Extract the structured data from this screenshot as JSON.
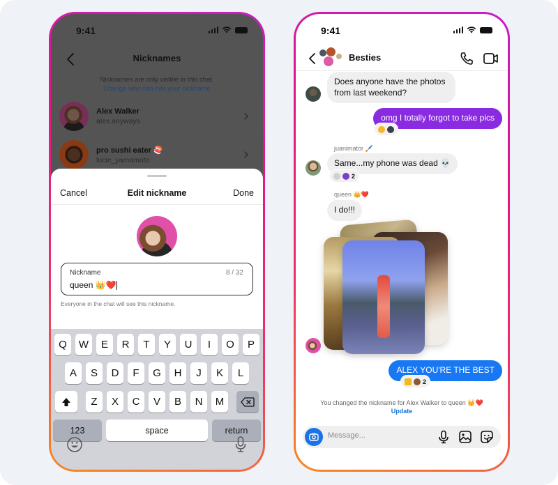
{
  "status_bar": {
    "time": "9:41"
  },
  "left_phone": {
    "nav": {
      "title": "Nicknames"
    },
    "note": {
      "line1": "Nicknames are only visible in this chat.",
      "link": "Change who can edit your nickname"
    },
    "members": [
      {
        "name": "Alex Walker",
        "username": "alex.anyways"
      },
      {
        "name": "pro sushi eater 🍣",
        "username": "lucie_yamamoto"
      }
    ],
    "sheet": {
      "cancel_label": "Cancel",
      "title": "Edit nickname",
      "done_label": "Done",
      "field_label": "Nickname",
      "field_value": "queen 👑❤️",
      "char_count": "8 / 32",
      "helper_text": "Everyone in the chat will see this nickname."
    },
    "keyboard": {
      "row1": [
        "Q",
        "W",
        "E",
        "R",
        "T",
        "Y",
        "U",
        "I",
        "O",
        "P"
      ],
      "row2": [
        "A",
        "S",
        "D",
        "F",
        "G",
        "H",
        "J",
        "K",
        "L"
      ],
      "row3": [
        "Z",
        "X",
        "C",
        "V",
        "B",
        "N",
        "M"
      ],
      "numbers_label": "123",
      "space_label": "space",
      "return_label": "return",
      "shift_icon": "shift-icon",
      "delete_icon": "backspace-icon",
      "emoji_icon": "emoji-icon",
      "mic_icon": "mic-icon"
    }
  },
  "right_phone": {
    "header": {
      "group_name": "Besties"
    },
    "messages": [
      {
        "direction": "in",
        "text": "Does anyone have the photos from last weekend?"
      },
      {
        "direction": "out",
        "text": "omg I totally forgot to take pics",
        "reactions": [
          "😟",
          "🧕"
        ]
      },
      {
        "direction": "in",
        "sender": "juanimator 🖌️",
        "text": "Same...my phone was dead 💀",
        "reactions": [
          "💀",
          "😈"
        ],
        "reaction_count": "2"
      },
      {
        "direction": "in",
        "sender": "queen 👑❤️",
        "text": "I do!!!"
      },
      {
        "direction": "in",
        "type": "photo-stack",
        "photo_count": 4
      },
      {
        "direction": "out",
        "text": "ALEX YOU'RE THE BEST",
        "reactions": [
          "👑",
          "🤘"
        ],
        "reaction_count": "2"
      }
    ],
    "system_note": {
      "text": "You changed the nickname for Alex Walker to queen 👑❤️",
      "action": "Update"
    },
    "composer": {
      "placeholder": "Message..."
    }
  },
  "colors": {
    "outgoing_purple": "#8a2be2",
    "outgoing_blue": "#1877f2",
    "link_blue": "#1a6fd1",
    "frame_gradient_start": "#c61ec8",
    "frame_gradient_end": "#f68a20"
  }
}
